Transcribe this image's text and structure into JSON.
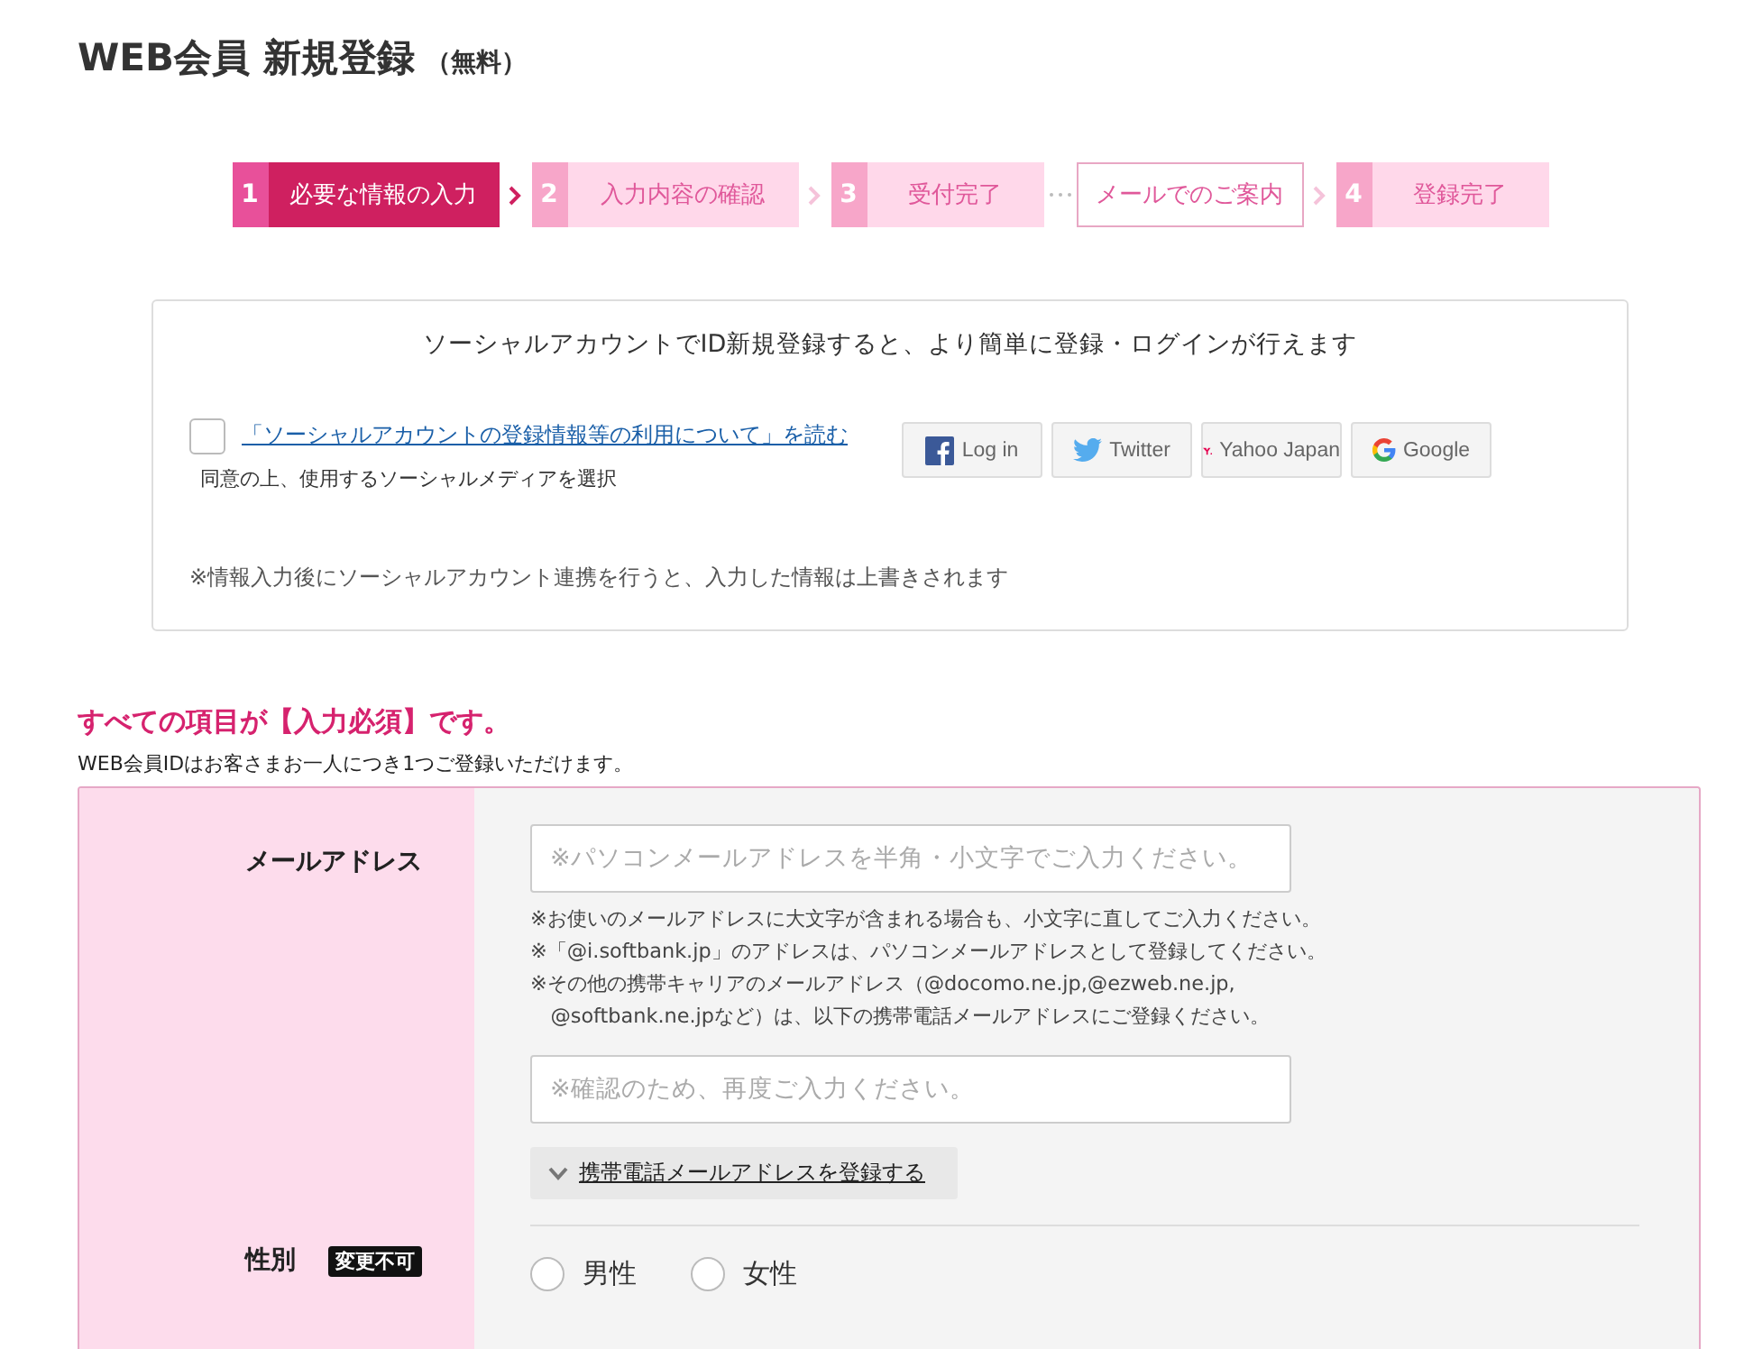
{
  "page": {
    "title": "WEB会員 新規登録",
    "title_note": "（無料）"
  },
  "steps": [
    {
      "kind": "step",
      "number": "1",
      "label": "必要な情報の入力",
      "selected": true
    },
    {
      "kind": "step",
      "number": "2",
      "label": "入力内容の確認",
      "selected": false
    },
    {
      "kind": "step",
      "number": "3",
      "label": "受付完了",
      "selected": false
    },
    {
      "kind": "note",
      "label": "メールでのご案内",
      "selected": false
    },
    {
      "kind": "step",
      "number": "4",
      "label": "登録完了",
      "selected": false
    }
  ],
  "social": {
    "heading": "ソーシャルアカウントでID新規登録すると、より簡単に登録・ログインが行えます",
    "agree_checked": false,
    "link": "「ソーシャルアカウントの登録情報等の利用について」を読む",
    "agree_hint": "同意の上、使用するソーシャルメディアを選択",
    "buttons": [
      {
        "kind": "facebook",
        "label": "Log in"
      },
      {
        "kind": "twitter",
        "label": "Twitter"
      },
      {
        "kind": "yahoo",
        "label": "Yahoo Japan"
      },
      {
        "kind": "google",
        "label": "Google"
      }
    ],
    "note": "※情報入力後にソーシャルアカウント連携を行うと、入力した情報は上書きされます"
  },
  "form": {
    "required_notice": "すべての項目が【入力必須】です。",
    "sub_notice": "WEB会員IDはお客さまお一人につき1つご登録いただけます。",
    "email": {
      "label": "メールアドレス",
      "placeholder": "※パソコンメールアドレスを半角・小文字でご入力ください。",
      "notes": [
        "※お使いのメールアドレスに大文字が含まれる場合も、小文字に直してご入力ください。",
        "※「@i.softbank.jp」のアドレスは、パソコンメールアドレスとして登録してください。",
        "※その他の携帯キャリアのメールアドレス（@docomo.ne.jp,@ezweb.ne.jp,\n@softbank.ne.jpなど）は、以下の携帯電話メールアドレスにご登録ください。"
      ],
      "confirm_placeholder": "※確認のため、再度ご入力ください。",
      "mobile_toggle": "携帯電話メールアドレスを登録する",
      "expanded": false
    },
    "gender": {
      "label": "性別",
      "badge": "変更不可",
      "options": [
        {
          "label": "男性",
          "selected": false
        },
        {
          "label": "女性",
          "selected": false
        }
      ]
    }
  }
}
